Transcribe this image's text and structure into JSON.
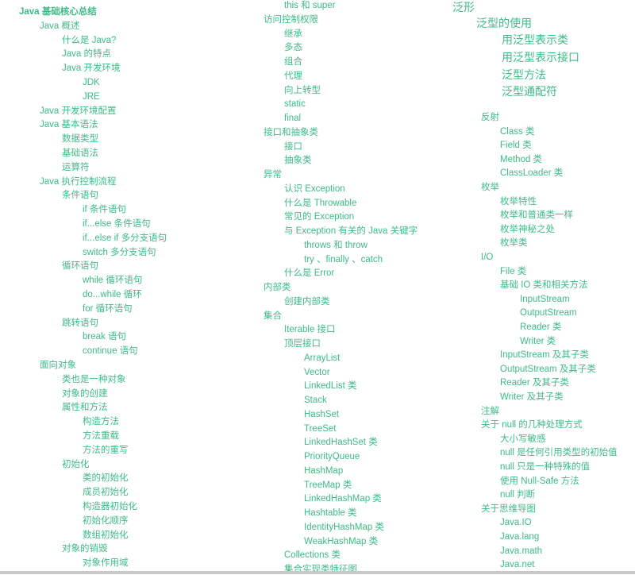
{
  "title": "Java 基础核心总结",
  "accent_color": "#3dbb86",
  "columns": [
    {
      "items": [
        {
          "text": "Java 基础核心总结",
          "level": 0
        },
        {
          "text": "Java 概述",
          "level": 1
        },
        {
          "text": "什么是 Java?",
          "level": 2
        },
        {
          "text": "Java 的特点",
          "level": 2
        },
        {
          "text": "Java 开发环境",
          "level": 2
        },
        {
          "text": "JDK",
          "level": 3
        },
        {
          "text": "JRE",
          "level": 3
        },
        {
          "text": "Java 开发环境配置",
          "level": 1
        },
        {
          "text": "Java 基本语法",
          "level": 1
        },
        {
          "text": "数据类型",
          "level": 2
        },
        {
          "text": "基础语法",
          "level": 2
        },
        {
          "text": "运算符",
          "level": 2
        },
        {
          "text": "Java 执行控制流程",
          "level": 1
        },
        {
          "text": "条件语句",
          "level": 2
        },
        {
          "text": "if 条件语句",
          "level": 3
        },
        {
          "text": "if...else 条件语句",
          "level": 3
        },
        {
          "text": "if...else if 多分支语句",
          "level": 3
        },
        {
          "text": "switch 多分支语句",
          "level": 3
        },
        {
          "text": "循环语句",
          "level": 2
        },
        {
          "text": "while 循环语句",
          "level": 3
        },
        {
          "text": "do...while 循环",
          "level": 3
        },
        {
          "text": "for 循环语句",
          "level": 3
        },
        {
          "text": "跳转语句",
          "level": 2
        },
        {
          "text": "break 语句",
          "level": 3
        },
        {
          "text": "continue 语句",
          "level": 3
        },
        {
          "text": "面向对象",
          "level": 1
        },
        {
          "text": "类也是一种对象",
          "level": 2
        },
        {
          "text": "对象的创建",
          "level": 2
        },
        {
          "text": "属性和方法",
          "level": 2
        },
        {
          "text": "构造方法",
          "level": 3
        },
        {
          "text": "方法重载",
          "level": 3
        },
        {
          "text": "方法的重写",
          "level": 3
        },
        {
          "text": "初始化",
          "level": 2
        },
        {
          "text": "类的初始化",
          "level": 3
        },
        {
          "text": "成员初始化",
          "level": 3
        },
        {
          "text": "构造器初始化",
          "level": 3
        },
        {
          "text": "初始化顺序",
          "level": 3
        },
        {
          "text": "数组初始化",
          "level": 3
        },
        {
          "text": "对象的销毁",
          "level": 2
        },
        {
          "text": "对象作用域",
          "level": 3
        }
      ]
    },
    {
      "items": [
        {
          "text": "this 和 super",
          "level": 2
        },
        {
          "text": "访问控制权限",
          "level": 1
        },
        {
          "text": "继承",
          "level": 2
        },
        {
          "text": "多态",
          "level": 2
        },
        {
          "text": "组合",
          "level": 2
        },
        {
          "text": "代理",
          "level": 2
        },
        {
          "text": "向上转型",
          "level": 2
        },
        {
          "text": "static",
          "level": 2
        },
        {
          "text": "final",
          "level": 2
        },
        {
          "text": "接口和抽象类",
          "level": 1
        },
        {
          "text": "接口",
          "level": 2
        },
        {
          "text": "抽象类",
          "level": 2
        },
        {
          "text": "异常",
          "level": 1
        },
        {
          "text": "认识 Exception",
          "level": 2
        },
        {
          "text": "什么是 Throwable",
          "level": 2
        },
        {
          "text": "常见的 Exception",
          "level": 2
        },
        {
          "text": "与 Exception 有关的 Java 关键字",
          "level": 2
        },
        {
          "text": "throws 和 throw",
          "level": 3
        },
        {
          "text": "try 、finally 、catch",
          "level": 3
        },
        {
          "text": "什么是 Error",
          "level": 2
        },
        {
          "text": "内部类",
          "level": 1
        },
        {
          "text": "创建内部类",
          "level": 2
        },
        {
          "text": "集合",
          "level": 1
        },
        {
          "text": "Iterable 接口",
          "level": 2
        },
        {
          "text": "顶层接口",
          "level": 2
        },
        {
          "text": "ArrayList",
          "level": 3
        },
        {
          "text": "Vector",
          "level": 3
        },
        {
          "text": "LinkedList 类",
          "level": 3
        },
        {
          "text": "Stack",
          "level": 3
        },
        {
          "text": "HashSet",
          "level": 3
        },
        {
          "text": "TreeSet",
          "level": 3
        },
        {
          "text": "LinkedHashSet 类",
          "level": 3
        },
        {
          "text": "PriorityQueue",
          "level": 3
        },
        {
          "text": "HashMap",
          "level": 3
        },
        {
          "text": "TreeMap 类",
          "level": 3
        },
        {
          "text": "LinkedHashMap 类",
          "level": 3
        },
        {
          "text": "Hashtable 类",
          "level": 3
        },
        {
          "text": "IdentityHashMap 类",
          "level": 3
        },
        {
          "text": "WeakHashMap 类",
          "level": 3
        },
        {
          "text": "Collections 类",
          "level": 2
        },
        {
          "text": "集合实现类特征图",
          "level": 2
        }
      ]
    },
    {
      "items": [
        {
          "text": "泛形",
          "level": 1
        },
        {
          "text": "泛型的使用",
          "level": 2
        },
        {
          "text": "用泛型表示类",
          "level": 3
        },
        {
          "text": "用泛型表示接口",
          "level": 3
        },
        {
          "text": "泛型方法",
          "level": 3
        },
        {
          "text": "泛型通配符",
          "level": 3
        },
        {
          "text": "反射",
          "level": 1
        },
        {
          "text": "Class 类",
          "level": 2
        },
        {
          "text": "Field 类",
          "level": 2
        },
        {
          "text": "Method 类",
          "level": 2
        },
        {
          "text": "ClassLoader 类",
          "level": 2
        },
        {
          "text": "枚举",
          "level": 1
        },
        {
          "text": "枚举特性",
          "level": 2
        },
        {
          "text": "枚举和普通类一样",
          "level": 2
        },
        {
          "text": "枚举神秘之处",
          "level": 2
        },
        {
          "text": "枚举类",
          "level": 2
        },
        {
          "text": "I/O",
          "level": 1
        },
        {
          "text": "File 类",
          "level": 2
        },
        {
          "text": "基础 IO 类和相关方法",
          "level": 2
        },
        {
          "text": "InputStream",
          "level": 3
        },
        {
          "text": "OutputStream",
          "level": 3
        },
        {
          "text": "Reader 类",
          "level": 3
        },
        {
          "text": "Writer 类",
          "level": 3
        },
        {
          "text": "InputStream 及其子类",
          "level": 2
        },
        {
          "text": "OutputStream 及其子类",
          "level": 2
        },
        {
          "text": "Reader 及其子类",
          "level": 2
        },
        {
          "text": "Writer 及其子类",
          "level": 2
        },
        {
          "text": "注解",
          "level": 1
        },
        {
          "text": "关于 null 的几种处理方式",
          "level": 1
        },
        {
          "text": "大小写敏感",
          "level": 2
        },
        {
          "text": "null 是任何引用类型的初始值",
          "level": 2
        },
        {
          "text": "null 只是一种特殊的值",
          "level": 2
        },
        {
          "text": "使用 Null-Safe 方法",
          "level": 2
        },
        {
          "text": "null 判断",
          "level": 2
        },
        {
          "text": "关于思维导图",
          "level": 1
        },
        {
          "text": "Java.IO",
          "level": 2
        },
        {
          "text": "Java.lang",
          "level": 2
        },
        {
          "text": "Java.math",
          "level": 2
        },
        {
          "text": "Java.net",
          "level": 2
        }
      ]
    }
  ]
}
